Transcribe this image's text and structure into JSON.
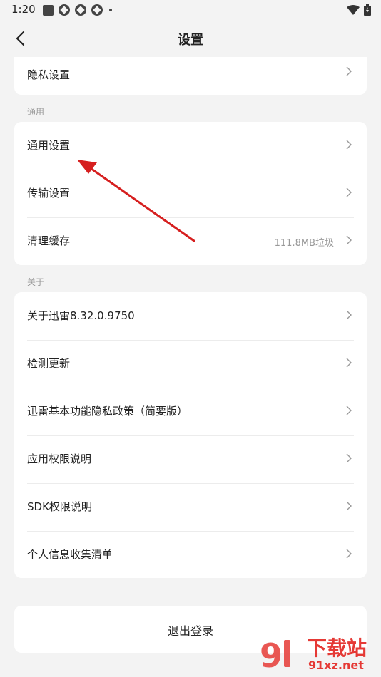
{
  "status": {
    "time": "1:20"
  },
  "header": {
    "title": "设置"
  },
  "card_privacy": {
    "label": "隐私设置"
  },
  "section_general": {
    "label": "通用"
  },
  "general_items": [
    {
      "label": "通用设置"
    },
    {
      "label": "传输设置"
    },
    {
      "label": "清理缓存",
      "extra": "111.8MB垃圾"
    }
  ],
  "section_about": {
    "label": "关于"
  },
  "about_items": [
    {
      "label": "关于迅雷8.32.0.9750"
    },
    {
      "label": "检测更新"
    },
    {
      "label": "迅雷基本功能隐私政策（简要版）"
    },
    {
      "label": "应用权限说明"
    },
    {
      "label": "SDK权限说明"
    },
    {
      "label": "个人信息收集清单"
    }
  ],
  "logout": {
    "label": "退出登录"
  },
  "watermark": {
    "brand": "下载站",
    "site": "91xz.net"
  },
  "colors": {
    "background": "#f3f3f3",
    "card": "#ffffff",
    "annotation_arrow": "#d61f1f"
  }
}
